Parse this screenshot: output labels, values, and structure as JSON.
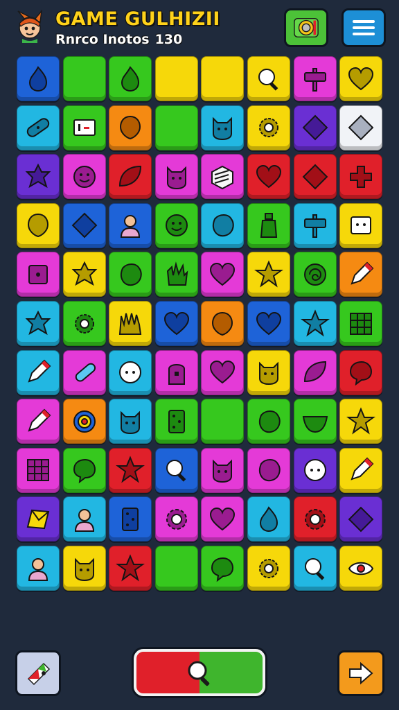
{
  "header": {
    "title": "GAME GULHIZII",
    "subtitle": "Rnrco Inotos",
    "score": "130"
  },
  "icons": {
    "settings": "gear-icon",
    "menu": "hamburger-menu-icon",
    "hint": "hint-card-icon",
    "search": "magnifier-icon",
    "next": "arrow-right-icon"
  },
  "colors": {
    "background": "#1f2a3c",
    "title": "#ffd21a",
    "search_left": "#e0202a",
    "search_right": "#3fb52d"
  },
  "board": {
    "rows": 11,
    "cols": 8,
    "tiles": [
      [
        [
          "blue",
          "flame"
        ],
        [
          "green",
          "none"
        ],
        [
          "green",
          "flame"
        ],
        [
          "yellow",
          "none"
        ],
        [
          "yellow",
          "none"
        ],
        [
          "yellow",
          "magnifier"
        ],
        [
          "magenta",
          "signpost"
        ],
        [
          "yellow",
          "heart"
        ]
      ],
      [
        [
          "teal",
          "bandage"
        ],
        [
          "green",
          "card"
        ],
        [
          "orange",
          "balloon"
        ],
        [
          "green",
          "none"
        ],
        [
          "teal",
          "cat"
        ],
        [
          "yellow",
          "flower"
        ],
        [
          "purple",
          "diamond"
        ],
        [
          "white",
          "diamond"
        ]
      ],
      [
        [
          "purple",
          "star-blob"
        ],
        [
          "magenta",
          "smiley"
        ],
        [
          "red",
          "leaf"
        ],
        [
          "magenta",
          "cat"
        ],
        [
          "magenta",
          "box"
        ],
        [
          "red",
          "heart"
        ],
        [
          "red",
          "diamond"
        ],
        [
          "red",
          "plus"
        ]
      ],
      [
        [
          "yellow",
          "balloon"
        ],
        [
          "blue",
          "diamond"
        ],
        [
          "blue",
          "person"
        ],
        [
          "green",
          "smiley"
        ],
        [
          "teal",
          "blob"
        ],
        [
          "green",
          "bottle"
        ],
        [
          "teal",
          "signpost"
        ],
        [
          "yellow",
          "face-box"
        ]
      ],
      [
        [
          "magenta",
          "square"
        ],
        [
          "yellow",
          "star-blob"
        ],
        [
          "green",
          "blob"
        ],
        [
          "green",
          "glove"
        ],
        [
          "magenta",
          "heart"
        ],
        [
          "yellow",
          "star"
        ],
        [
          "green",
          "swirl"
        ],
        [
          "orange",
          "pencil"
        ]
      ],
      [
        [
          "teal",
          "star-blob"
        ],
        [
          "green",
          "flower"
        ],
        [
          "yellow",
          "grass"
        ],
        [
          "blue",
          "heart"
        ],
        [
          "orange",
          "balloon"
        ],
        [
          "blue",
          "heart"
        ],
        [
          "teal",
          "star"
        ],
        [
          "green",
          "grid"
        ]
      ],
      [
        [
          "teal",
          "pencil"
        ],
        [
          "magenta",
          "crayon"
        ],
        [
          "teal",
          "button"
        ],
        [
          "magenta",
          "tombstone"
        ],
        [
          "magenta",
          "heart"
        ],
        [
          "yellow",
          "cat"
        ],
        [
          "magenta",
          "leaf"
        ],
        [
          "red",
          "chat"
        ]
      ],
      [
        [
          "magenta",
          "pencil"
        ],
        [
          "orange",
          "target"
        ],
        [
          "teal",
          "cat"
        ],
        [
          "green",
          "domino"
        ],
        [
          "green",
          "none"
        ],
        [
          "green",
          "blob"
        ],
        [
          "green",
          "bowl"
        ],
        [
          "yellow",
          "star"
        ]
      ],
      [
        [
          "magenta",
          "grid"
        ],
        [
          "green",
          "chat"
        ],
        [
          "red",
          "star"
        ],
        [
          "blue",
          "magnifier"
        ],
        [
          "magenta",
          "cat"
        ],
        [
          "magenta",
          "blob"
        ],
        [
          "purple",
          "button"
        ],
        [
          "yellow",
          "pencil"
        ]
      ],
      [
        [
          "purple",
          "envelope"
        ],
        [
          "teal",
          "person"
        ],
        [
          "blue",
          "domino"
        ],
        [
          "magenta",
          "gear"
        ],
        [
          "magenta",
          "heart"
        ],
        [
          "teal",
          "flame"
        ],
        [
          "red",
          "gear"
        ],
        [
          "purple",
          "diamond"
        ]
      ],
      [
        [
          "teal",
          "person"
        ],
        [
          "yellow",
          "cat"
        ],
        [
          "red",
          "star"
        ],
        [
          "green",
          "none"
        ],
        [
          "green",
          "chat"
        ],
        [
          "yellow",
          "flower"
        ],
        [
          "teal",
          "magnifier"
        ],
        [
          "yellow",
          "eye"
        ]
      ]
    ]
  }
}
